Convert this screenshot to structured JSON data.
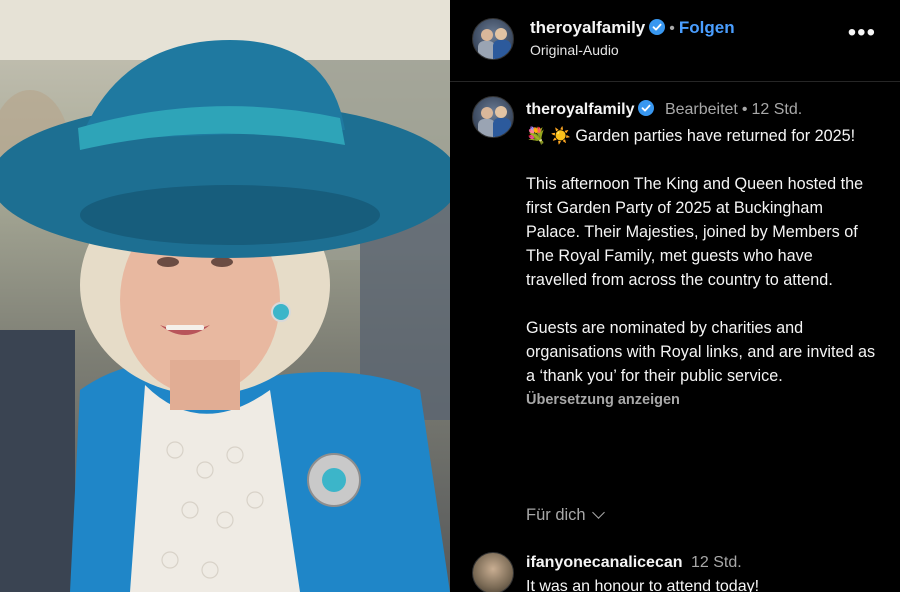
{
  "header": {
    "username": "theroyalfamily",
    "follow_label": "Folgen",
    "audio_label": "Original-Audio",
    "more_label": "•••"
  },
  "post": {
    "username": "theroyalfamily",
    "edited_label": "Bearbeitet",
    "time": "12 Std.",
    "emoji": "💐 ☀️",
    "caption_line1": "Garden parties have returned for 2025!",
    "caption_para2": "This afternoon The King and Queen hosted the first Garden Party of 2025 at Buckingham Palace. Their Majesties, joined by Members of The Royal Family, met guests who have travelled from across the country to attend.",
    "caption_para3": "Guests are nominated by charities and organisations with Royal links, and are invited as a ‘thank you’ for their public service.",
    "translate_label": "Übersetzung anzeigen",
    "for_you_label": "Für dich"
  },
  "comment": {
    "username": "ifanyonecanalicecan",
    "time": "12 Std.",
    "text": "It was an honour to attend today!"
  },
  "colors": {
    "background": "#000000",
    "accent_blue": "#4a9eff",
    "verified_blue": "#3897f0",
    "muted_text": "#a8a8a8",
    "hat_teal": "#1d6f92",
    "jacket_blue": "#1f86c8"
  }
}
